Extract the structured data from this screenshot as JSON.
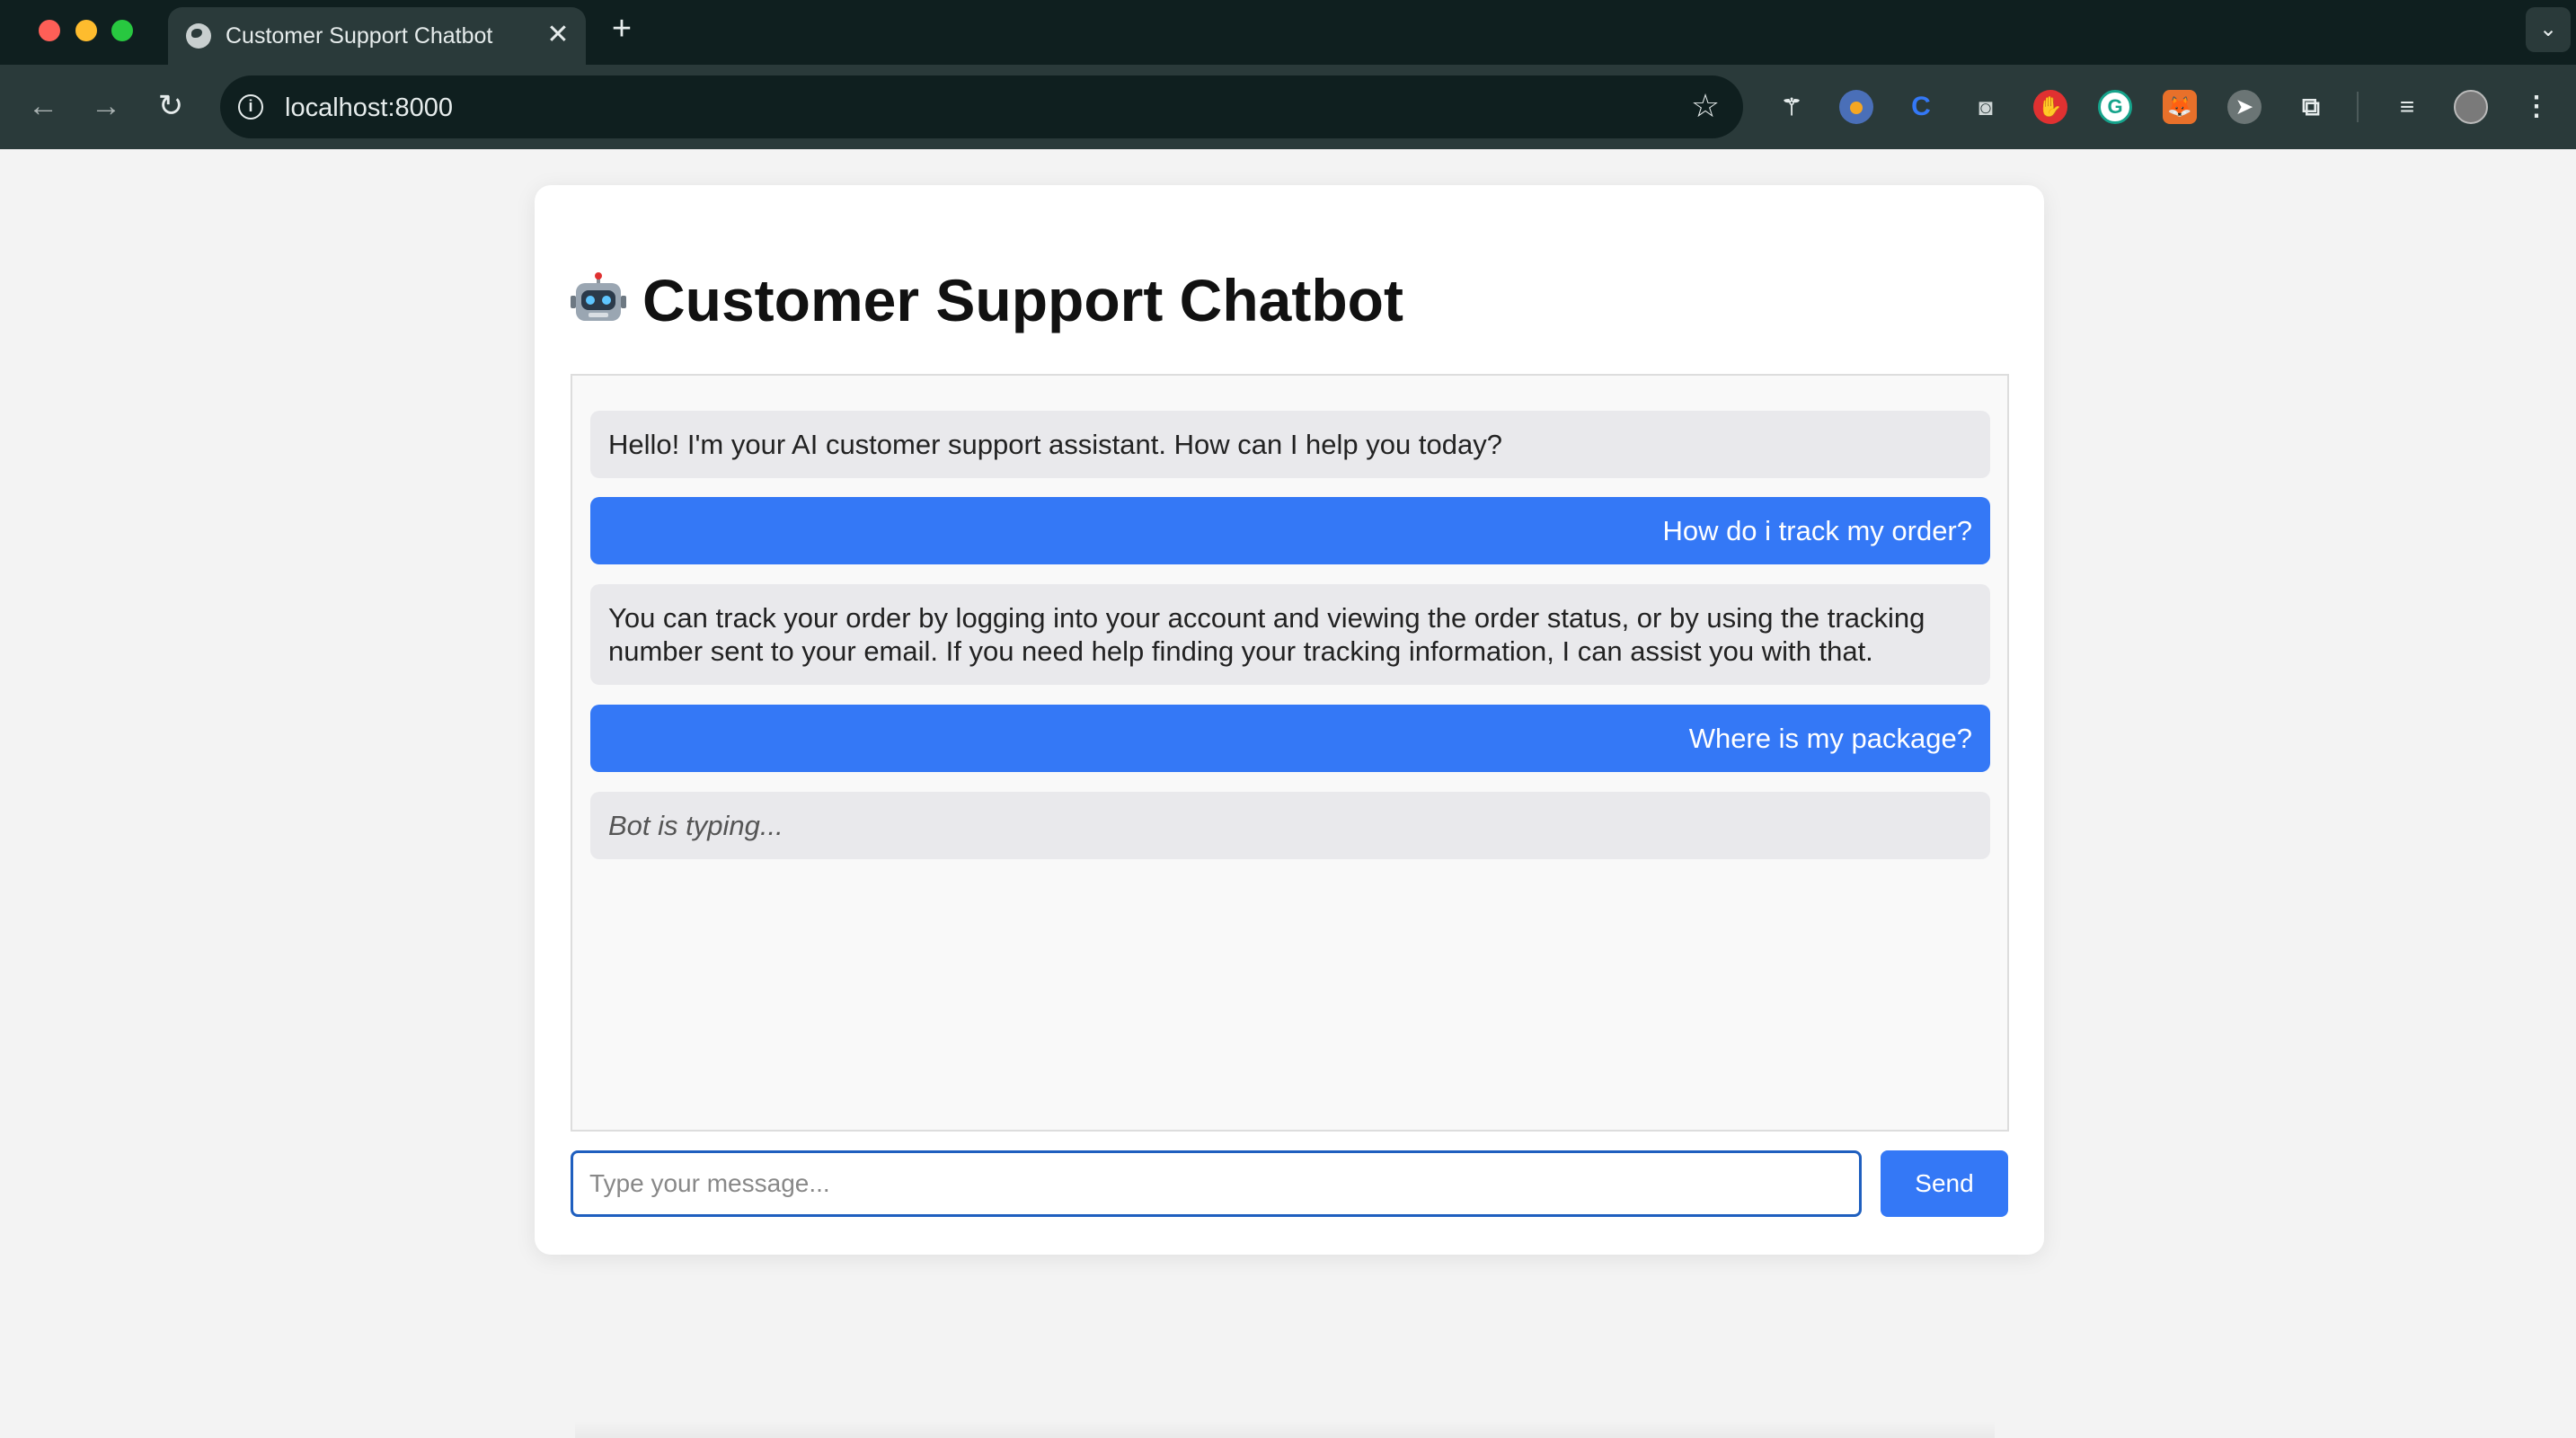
{
  "browser": {
    "tab_title": "Customer Support Chatbot",
    "tab_close": "✕",
    "new_tab": "+",
    "url": "localhost:8000",
    "icons": {
      "back": "arrow-left-icon",
      "forward": "arrow-right-icon",
      "reload": "reload-icon",
      "info": "info-icon",
      "star": "star-icon",
      "extensions": [
        "wand-icon",
        "compass-icon",
        "c-extension-icon",
        "camera-icon",
        "hand-icon",
        "grammarly-icon",
        "fox-icon",
        "send-icon",
        "puzzle-icon",
        "media-icon",
        "profile-avatar-icon",
        "more-menu-icon"
      ]
    }
  },
  "page": {
    "title": "Customer Support Chatbot",
    "title_icon": "robot-icon",
    "messages": [
      {
        "sender": "bot",
        "text": "Hello! I'm your AI customer support assistant. How can I help you today?"
      },
      {
        "sender": "user",
        "text": "How do i track my order?"
      },
      {
        "sender": "bot",
        "text": "You can track your order by logging into your account and viewing the order status, or by using the tracking number sent to your email. If you need help finding your tracking information, I can assist you with that."
      },
      {
        "sender": "user",
        "text": "Where is my package?"
      },
      {
        "sender": "bot",
        "text": "Bot is typing..."
      }
    ],
    "input": {
      "placeholder": "Type your message...",
      "value": ""
    },
    "send_label": "Send"
  },
  "colors": {
    "accent": "#3478f6",
    "bot_bubble": "#e9e9ec",
    "chrome_dark": "#0f1f1f",
    "chrome_toolbar": "#2a3a3a"
  }
}
